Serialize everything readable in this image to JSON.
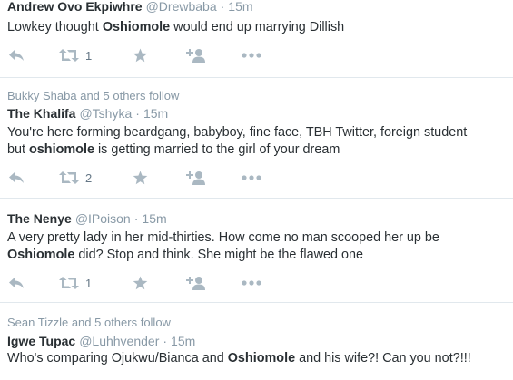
{
  "tweets": [
    {
      "context": "",
      "name": "Andrew Ovo Ekpiwhre",
      "handle": "@Drewbaba",
      "dot": "·",
      "time": "15m",
      "lines": [
        {
          "before": "Lowkey thought ",
          "bold": "Oshiomole",
          "after": " would end up marrying Dillish"
        }
      ],
      "retweets": "1"
    },
    {
      "context": "Bukky Shaba and 5 others follow",
      "name": "The Khalifa",
      "handle": "@Tshyka",
      "dot": "·",
      "time": "15m",
      "lines": [
        {
          "before": "You're here forming beardgang, babyboy, fine face, TBH Twitter, foreign student",
          "bold": "",
          "after": ""
        },
        {
          "before": "but ",
          "bold": "oshiomole",
          "after": " is getting married to the girl of your dream"
        }
      ],
      "retweets": "2"
    },
    {
      "context": "",
      "name": "The Nenye",
      "handle": "@IPoison",
      "dot": "·",
      "time": "15m",
      "lines": [
        {
          "before": "A very pretty lady in her mid-thirties. How come no man scooped her up be",
          "bold": "",
          "after": ""
        },
        {
          "before": "",
          "bold": "Oshiomole",
          "after": " did? Stop and think. She might be the flawed one"
        }
      ],
      "retweets": "1"
    },
    {
      "context": "Sean Tizzle and 5 others follow",
      "name": "Igwe Tupac",
      "handle": "@Luhhvender",
      "dot": "·",
      "time": "15m",
      "lines": [
        {
          "before": "Who's comparing Ojukwu/Bianca and ",
          "bold": "Oshiomole",
          "after": " and his wife?! Can you not?!!!"
        }
      ],
      "retweets": ""
    }
  ],
  "icons": {
    "reply": "reply-icon",
    "retweet": "retweet-icon",
    "like": "star-icon",
    "follow": "add-user-icon",
    "more": "more-icon"
  }
}
